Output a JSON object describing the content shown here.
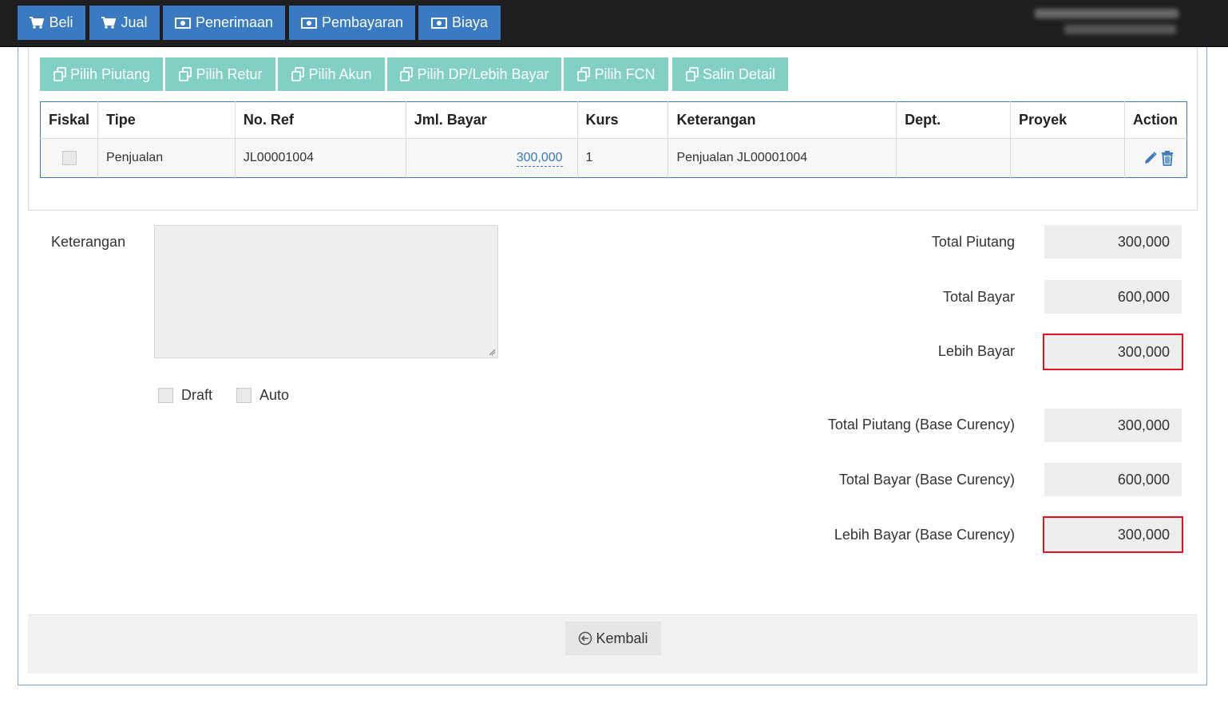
{
  "nav": {
    "buttons": [
      {
        "label": "Beli",
        "icon": "cart-icon"
      },
      {
        "label": "Jual",
        "icon": "cart-icon"
      },
      {
        "label": "Penerimaan",
        "icon": "money-icon"
      },
      {
        "label": "Pembayaran",
        "icon": "money-icon"
      },
      {
        "label": "Biaya",
        "icon": "money-icon"
      }
    ]
  },
  "toolbar": {
    "buttons": [
      {
        "label": "Pilih Piutang",
        "icon": "copy-icon"
      },
      {
        "label": "Pilih Retur",
        "icon": "copy-icon"
      },
      {
        "label": "Pilih Akun",
        "icon": "copy-icon"
      },
      {
        "label": "Pilih DP/Lebih Bayar",
        "icon": "copy-icon"
      },
      {
        "label": "Pilih FCN",
        "icon": "copy-icon"
      },
      {
        "label": "Salin Detail",
        "icon": "copy-icon"
      }
    ]
  },
  "table": {
    "headers": [
      "Fiskal",
      "Tipe",
      "No. Ref",
      "Jml. Bayar",
      "Kurs",
      "Keterangan",
      "Dept.",
      "Proyek",
      "Action"
    ],
    "rows": [
      {
        "fiskal": false,
        "tipe": "Penjualan",
        "no_ref": "JL00001004",
        "jml_bayar": "300,000",
        "kurs": "1",
        "keterangan": "Penjualan JL00001004",
        "dept": "",
        "proyek": ""
      }
    ]
  },
  "form": {
    "keterangan_label": "Keterangan",
    "keterangan_value": "",
    "draft_label": "Draft",
    "auto_label": "Auto",
    "draft_checked": false,
    "auto_checked": false
  },
  "summary": {
    "total_piutang_label": "Total Piutang",
    "total_piutang": "300,000",
    "total_bayar_label": "Total Bayar",
    "total_bayar": "600,000",
    "lebih_bayar_label": "Lebih Bayar",
    "lebih_bayar": "300,000",
    "total_piutang_base_label": "Total Piutang (Base Curency)",
    "total_piutang_base": "300,000",
    "total_bayar_base_label": "Total Bayar (Base Curency)",
    "total_bayar_base": "600,000",
    "lebih_bayar_base_label": "Lebih Bayar (Base Curency)",
    "lebih_bayar_base": "300,000"
  },
  "footer": {
    "back_label": "Kembali"
  },
  "colors": {
    "nav_blue": "#3a7ac2",
    "teal": "#82cfc4",
    "highlight_red": "#e0141e",
    "topbar": "#1e1e1e"
  }
}
